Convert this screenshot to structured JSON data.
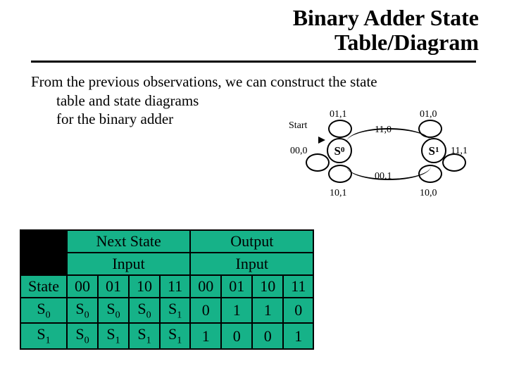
{
  "title_line1": "Binary Adder State",
  "title_line2": "Table/Diagram",
  "lead_line1": "From the previous observations, we can construct the state",
  "lead_line2": "table and state diagrams",
  "lead_line3": "for the binary adder",
  "diagram": {
    "start": "Start",
    "s0": "S",
    "s0_sub": "0",
    "s1": "S",
    "s1_sub": "1",
    "l_s0_top": "01,1",
    "l_s1_top": "01,0",
    "l_s0s1": "11,0",
    "l_s0_self": "00,0",
    "l_s1_self": "11,1",
    "l_s1s0": "00,1",
    "l_s0_bot": "10,1",
    "l_s1_bot": "10,0"
  },
  "table": {
    "group_next": "Next State",
    "group_out": "Output",
    "input_label": "Input",
    "state_label": "State",
    "cols": [
      "00",
      "01",
      "10",
      "11"
    ],
    "row0_state": "S",
    "row0_sub": "0",
    "row1_state": "S",
    "row1_sub": "1",
    "next": {
      "r0": [
        [
          "S",
          "0"
        ],
        [
          "S",
          "0"
        ],
        [
          "S",
          "0"
        ],
        [
          "S",
          "1"
        ]
      ],
      "r1": [
        [
          "S",
          "0"
        ],
        [
          "S",
          "1"
        ],
        [
          "S",
          "1"
        ],
        [
          "S",
          "1"
        ]
      ]
    },
    "out": {
      "r0": [
        "0",
        "1",
        "1",
        "0"
      ],
      "r1": [
        "1",
        "0",
        "0",
        "1"
      ]
    }
  },
  "chart_data": {
    "type": "table",
    "title": "Binary Adder State Table",
    "columns": [
      "State",
      "Next(00)",
      "Next(01)",
      "Next(10)",
      "Next(11)",
      "Out(00)",
      "Out(01)",
      "Out(10)",
      "Out(11)"
    ],
    "rows": [
      [
        "S0",
        "S0",
        "S0",
        "S0",
        "S1",
        "0",
        "1",
        "1",
        "0"
      ],
      [
        "S1",
        "S0",
        "S1",
        "S1",
        "S1",
        "1",
        "0",
        "0",
        "1"
      ]
    ],
    "diagram": {
      "states": [
        "S0",
        "S1"
      ],
      "start": "S0",
      "transitions": [
        {
          "from": "S0",
          "to": "S0",
          "input": "00",
          "output": "0"
        },
        {
          "from": "S0",
          "to": "S0",
          "input": "01",
          "output": "1"
        },
        {
          "from": "S0",
          "to": "S0",
          "input": "10",
          "output": "1"
        },
        {
          "from": "S0",
          "to": "S1",
          "input": "11",
          "output": "0"
        },
        {
          "from": "S1",
          "to": "S0",
          "input": "00",
          "output": "1"
        },
        {
          "from": "S1",
          "to": "S1",
          "input": "01",
          "output": "0"
        },
        {
          "from": "S1",
          "to": "S1",
          "input": "10",
          "output": "0"
        },
        {
          "from": "S1",
          "to": "S1",
          "input": "11",
          "output": "1"
        }
      ]
    }
  }
}
